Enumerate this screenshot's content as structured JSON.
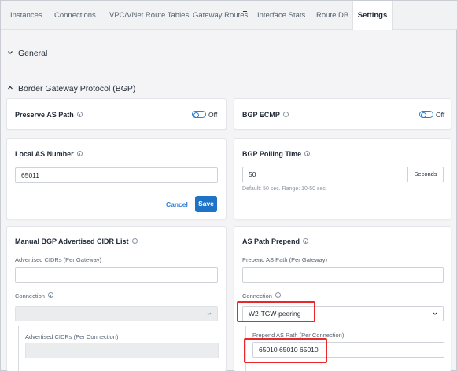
{
  "tabs": [
    {
      "label": "Instances"
    },
    {
      "label": "Connections"
    },
    {
      "label": "VPC/VNet Route Tables"
    },
    {
      "label": "Gateway Routes"
    },
    {
      "label": "Interface Stats"
    },
    {
      "label": "Route DB"
    },
    {
      "label": "Settings",
      "active": true
    }
  ],
  "sections": {
    "general": "General",
    "bgp": "Border Gateway Protocol (BGP)"
  },
  "preserve_as_path": {
    "title": "Preserve AS Path",
    "state": "Off"
  },
  "bgp_ecmp": {
    "title": "BGP ECMP",
    "state": "Off"
  },
  "local_as": {
    "title": "Local AS Number",
    "value": "65011",
    "cancel_label": "Cancel",
    "save_label": "Save"
  },
  "bgp_polling": {
    "title": "BGP Polling Time",
    "value": "50",
    "unit": "Seconds",
    "hint": "Default: 50 sec. Range: 10-50 sec."
  },
  "manual_cidr": {
    "title": "Manual BGP Advertised CIDR List",
    "gateway_label": "Advertised CIDRs (Per Gateway)",
    "connection_label": "Connection",
    "per_connection_label": "Advertised CIDRs (Per Connection)"
  },
  "as_path_prepend": {
    "title": "AS Path Prepend",
    "gateway_label": "Prepend AS Path (Per Gateway)",
    "connection_label": "Connection",
    "connection_value": "W2-TGW-peering",
    "per_connection_label": "Prepend AS Path (Per Connection)",
    "per_connection_value": "65010 65010 65010"
  },
  "colors": {
    "accent": "#1f73c6",
    "highlight": "#e8282b"
  },
  "icons": {
    "section_collapsed": "chevron-down-icon",
    "section_expanded": "chevron-up-icon",
    "info": "info-icon",
    "dropdown": "chevron-down-icon"
  }
}
